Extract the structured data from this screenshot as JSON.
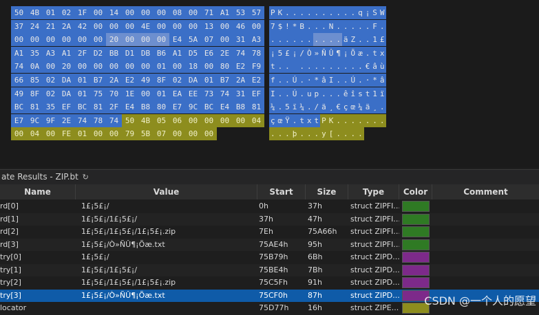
{
  "hex_rows": [
    {
      "bytes": [
        [
          "50",
          "b"
        ],
        [
          "4B",
          "b"
        ],
        [
          "01",
          "b"
        ],
        [
          "02",
          "b"
        ],
        [
          "1F",
          "b"
        ],
        [
          "00",
          "b"
        ],
        [
          "14",
          "b"
        ],
        [
          "00",
          "b"
        ],
        [
          "00",
          "b"
        ],
        [
          "00",
          "b"
        ],
        [
          "08",
          "b"
        ],
        [
          "00",
          "b"
        ],
        [
          "71",
          "b"
        ],
        [
          "A1",
          "b"
        ],
        [
          "53",
          "b"
        ],
        [
          "57",
          "b"
        ]
      ],
      "text": [
        [
          "P",
          "b"
        ],
        [
          "K",
          "b"
        ],
        [
          ".",
          "b"
        ],
        [
          ".",
          "b"
        ],
        [
          ".",
          "b"
        ],
        [
          ".",
          "b"
        ],
        [
          ".",
          "b"
        ],
        [
          ".",
          "b"
        ],
        [
          ".",
          "b"
        ],
        [
          ".",
          "b"
        ],
        [
          ".",
          "b"
        ],
        [
          ".",
          "b"
        ],
        [
          "q",
          "b"
        ],
        [
          "¡",
          "b"
        ],
        [
          "S",
          "b"
        ],
        [
          "W",
          "b"
        ]
      ]
    },
    {
      "bytes": [
        [
          "37",
          "b"
        ],
        [
          "24",
          "b"
        ],
        [
          "21",
          "b"
        ],
        [
          "2A",
          "b"
        ],
        [
          "42",
          "b"
        ],
        [
          "00",
          "b"
        ],
        [
          "00",
          "b"
        ],
        [
          "00",
          "b"
        ],
        [
          "4E",
          "b"
        ],
        [
          "00",
          "b"
        ],
        [
          "00",
          "b"
        ],
        [
          "00",
          "b"
        ],
        [
          "13",
          "b"
        ],
        [
          "00",
          "b"
        ],
        [
          "46",
          "b"
        ],
        [
          "00",
          "b"
        ]
      ],
      "text": [
        [
          "7",
          "b"
        ],
        [
          "$",
          "b"
        ],
        [
          "!",
          "b"
        ],
        [
          "*",
          "b"
        ],
        [
          "B",
          "b"
        ],
        [
          ".",
          "b"
        ],
        [
          ".",
          "b"
        ],
        [
          ".",
          "b"
        ],
        [
          "N",
          "b"
        ],
        [
          ".",
          "b"
        ],
        [
          ".",
          "b"
        ],
        [
          ".",
          "b"
        ],
        [
          ".",
          "b"
        ],
        [
          ".",
          "b"
        ],
        [
          "F",
          "b"
        ],
        [
          ".",
          "b"
        ]
      ]
    },
    {
      "bytes": [
        [
          "00",
          "b"
        ],
        [
          "00",
          "b"
        ],
        [
          "00",
          "b"
        ],
        [
          "00",
          "b"
        ],
        [
          "00",
          "b"
        ],
        [
          "00",
          "b"
        ],
        [
          "20",
          "bl"
        ],
        [
          "00",
          "bl"
        ],
        [
          "00",
          "bl"
        ],
        [
          "00",
          "bl"
        ],
        [
          "E4",
          "b"
        ],
        [
          "5A",
          "b"
        ],
        [
          "07",
          "b"
        ],
        [
          "00",
          "b"
        ],
        [
          "31",
          "b"
        ],
        [
          "A3",
          "b"
        ]
      ],
      "text": [
        [
          ".",
          "b"
        ],
        [
          ".",
          "b"
        ],
        [
          ".",
          "b"
        ],
        [
          ".",
          "b"
        ],
        [
          ".",
          "b"
        ],
        [
          ".",
          "b"
        ],
        [
          ".",
          "bl"
        ],
        [
          ".",
          "bl"
        ],
        [
          ".",
          "bl"
        ],
        [
          ".",
          "bl"
        ],
        [
          "ä",
          "b"
        ],
        [
          "Z",
          "b"
        ],
        [
          ".",
          "b"
        ],
        [
          ".",
          "b"
        ],
        [
          "1",
          "b"
        ],
        [
          "£",
          "b"
        ]
      ]
    },
    {
      "bytes": [
        [
          "A1",
          "b"
        ],
        [
          "35",
          "b"
        ],
        [
          "A3",
          "b"
        ],
        [
          "A1",
          "b"
        ],
        [
          "2F",
          "b"
        ],
        [
          "D2",
          "b"
        ],
        [
          "BB",
          "b"
        ],
        [
          "D1",
          "b"
        ],
        [
          "DB",
          "b"
        ],
        [
          "B6",
          "b"
        ],
        [
          "A1",
          "b"
        ],
        [
          "D5",
          "b"
        ],
        [
          "E6",
          "b"
        ],
        [
          "2E",
          "b"
        ],
        [
          "74",
          "b"
        ],
        [
          "78",
          "b"
        ]
      ],
      "text": [
        [
          "¡",
          "b"
        ],
        [
          "5",
          "b"
        ],
        [
          "£",
          "b"
        ],
        [
          "¡",
          "b"
        ],
        [
          "/",
          "b"
        ],
        [
          "Ò",
          "b"
        ],
        [
          "»",
          "b"
        ],
        [
          "Ñ",
          "b"
        ],
        [
          "Û",
          "b"
        ],
        [
          "¶",
          "b"
        ],
        [
          "¡",
          "b"
        ],
        [
          "Õ",
          "b"
        ],
        [
          "æ",
          "b"
        ],
        [
          ".",
          "b"
        ],
        [
          "t",
          "b"
        ],
        [
          "x",
          "b"
        ]
      ]
    },
    {
      "bytes": [
        [
          "74",
          "b"
        ],
        [
          "0A",
          "b"
        ],
        [
          "00",
          "b"
        ],
        [
          "20",
          "b"
        ],
        [
          "00",
          "b"
        ],
        [
          "00",
          "b"
        ],
        [
          "00",
          "b"
        ],
        [
          "00",
          "b"
        ],
        [
          "00",
          "b"
        ],
        [
          "01",
          "b"
        ],
        [
          "00",
          "b"
        ],
        [
          "18",
          "b"
        ],
        [
          "00",
          "b"
        ],
        [
          "80",
          "b"
        ],
        [
          "E2",
          "b"
        ],
        [
          "F9",
          "b"
        ]
      ],
      "text": [
        [
          "t",
          "b"
        ],
        [
          ".",
          "b"
        ],
        [
          ".",
          "b"
        ],
        [
          " ",
          "b"
        ],
        [
          ".",
          "b"
        ],
        [
          ".",
          "b"
        ],
        [
          ".",
          "b"
        ],
        [
          ".",
          "b"
        ],
        [
          ".",
          "b"
        ],
        [
          ".",
          "b"
        ],
        [
          ".",
          "b"
        ],
        [
          ".",
          "b"
        ],
        [
          ".",
          "b"
        ],
        [
          "€",
          "b"
        ],
        [
          "â",
          "b"
        ],
        [
          "ù",
          "b"
        ]
      ]
    },
    {
      "bytes": [
        [
          "66",
          "b"
        ],
        [
          "85",
          "b"
        ],
        [
          "02",
          "b"
        ],
        [
          "DA",
          "b"
        ],
        [
          "01",
          "b"
        ],
        [
          "B7",
          "b"
        ],
        [
          "2A",
          "b"
        ],
        [
          "E2",
          "b"
        ],
        [
          "49",
          "b"
        ],
        [
          "8F",
          "b"
        ],
        [
          "02",
          "b"
        ],
        [
          "DA",
          "b"
        ],
        [
          "01",
          "b"
        ],
        [
          "B7",
          "b"
        ],
        [
          "2A",
          "b"
        ],
        [
          "E2",
          "b"
        ]
      ],
      "text": [
        [
          "f",
          "b"
        ],
        [
          ".",
          "b"
        ],
        [
          ".",
          "b"
        ],
        [
          "Ú",
          "b"
        ],
        [
          ".",
          "b"
        ],
        [
          "·",
          "b"
        ],
        [
          "*",
          "b"
        ],
        [
          "â",
          "b"
        ],
        [
          "I",
          "b"
        ],
        [
          ".",
          "b"
        ],
        [
          ".",
          "b"
        ],
        [
          "Ú",
          "b"
        ],
        [
          ".",
          "b"
        ],
        [
          "·",
          "b"
        ],
        [
          "*",
          "b"
        ],
        [
          "â",
          "b"
        ]
      ]
    },
    {
      "bytes": [
        [
          "49",
          "b"
        ],
        [
          "8F",
          "b"
        ],
        [
          "02",
          "b"
        ],
        [
          "DA",
          "b"
        ],
        [
          "01",
          "b"
        ],
        [
          "75",
          "b"
        ],
        [
          "70",
          "b"
        ],
        [
          "1E",
          "b"
        ],
        [
          "00",
          "b"
        ],
        [
          "01",
          "b"
        ],
        [
          "EA",
          "b"
        ],
        [
          "EE",
          "b"
        ],
        [
          "73",
          "b"
        ],
        [
          "74",
          "b"
        ],
        [
          "31",
          "b"
        ],
        [
          "EF",
          "b"
        ]
      ],
      "text": [
        [
          "I",
          "b"
        ],
        [
          ".",
          "b"
        ],
        [
          ".",
          "b"
        ],
        [
          "Ú",
          "b"
        ],
        [
          ".",
          "b"
        ],
        [
          "u",
          "b"
        ],
        [
          "p",
          "b"
        ],
        [
          ".",
          "b"
        ],
        [
          ".",
          "b"
        ],
        [
          ".",
          "b"
        ],
        [
          "ê",
          "b"
        ],
        [
          "î",
          "b"
        ],
        [
          "s",
          "b"
        ],
        [
          "t",
          "b"
        ],
        [
          "1",
          "b"
        ],
        [
          "ï",
          "b"
        ]
      ]
    },
    {
      "bytes": [
        [
          "BC",
          "b"
        ],
        [
          "81",
          "b"
        ],
        [
          "35",
          "b"
        ],
        [
          "EF",
          "b"
        ],
        [
          "BC",
          "b"
        ],
        [
          "81",
          "b"
        ],
        [
          "2F",
          "b"
        ],
        [
          "E4",
          "b"
        ],
        [
          "B8",
          "b"
        ],
        [
          "80",
          "b"
        ],
        [
          "E7",
          "b"
        ],
        [
          "9C",
          "b"
        ],
        [
          "BC",
          "b"
        ],
        [
          "E4",
          "b"
        ],
        [
          "B8",
          "b"
        ],
        [
          "81",
          "b"
        ]
      ],
      "text": [
        [
          "¼",
          "b"
        ],
        [
          ".",
          "b"
        ],
        [
          "5",
          "b"
        ],
        [
          "ï",
          "b"
        ],
        [
          "¼",
          "b"
        ],
        [
          ".",
          "b"
        ],
        [
          "/",
          "b"
        ],
        [
          "ä",
          "b"
        ],
        [
          "¸",
          "b"
        ],
        [
          "€",
          "b"
        ],
        [
          "ç",
          "b"
        ],
        [
          "œ",
          "b"
        ],
        [
          "¼",
          "b"
        ],
        [
          "ä",
          "b"
        ],
        [
          "¸",
          "b"
        ],
        [
          ".",
          "b"
        ]
      ]
    },
    {
      "bytes": [
        [
          "E7",
          "b"
        ],
        [
          "9C",
          "b"
        ],
        [
          "9F",
          "b"
        ],
        [
          "2E",
          "b"
        ],
        [
          "74",
          "b"
        ],
        [
          "78",
          "b"
        ],
        [
          "74",
          "b"
        ],
        [
          "50",
          "g"
        ],
        [
          "4B",
          "g"
        ],
        [
          "05",
          "g"
        ],
        [
          "06",
          "g"
        ],
        [
          "00",
          "g"
        ],
        [
          "00",
          "g"
        ],
        [
          "00",
          "g"
        ],
        [
          "00",
          "g"
        ],
        [
          "04",
          "g"
        ]
      ],
      "text": [
        [
          "ç",
          "b"
        ],
        [
          "œ",
          "b"
        ],
        [
          "Ÿ",
          "b"
        ],
        [
          ".",
          "b"
        ],
        [
          "t",
          "b"
        ],
        [
          "x",
          "b"
        ],
        [
          "t",
          "b"
        ],
        [
          "P",
          "g"
        ],
        [
          "K",
          "g"
        ],
        [
          ".",
          "g"
        ],
        [
          ".",
          "g"
        ],
        [
          ".",
          "g"
        ],
        [
          ".",
          "g"
        ],
        [
          ".",
          "g"
        ],
        [
          ".",
          "g"
        ],
        [
          ".",
          "g"
        ]
      ]
    },
    {
      "bytes": [
        [
          "00",
          "g"
        ],
        [
          "04",
          "g"
        ],
        [
          "00",
          "g"
        ],
        [
          "FE",
          "g"
        ],
        [
          "01",
          "g"
        ],
        [
          "00",
          "g"
        ],
        [
          "00",
          "g"
        ],
        [
          "79",
          "g"
        ],
        [
          "5B",
          "g"
        ],
        [
          "07",
          "g"
        ],
        [
          "00",
          "g"
        ],
        [
          "00",
          "g"
        ],
        [
          "00",
          "g"
        ]
      ],
      "text": [
        [
          ".",
          "g"
        ],
        [
          ".",
          "g"
        ],
        [
          ".",
          "g"
        ],
        [
          "þ",
          "g"
        ],
        [
          ".",
          "g"
        ],
        [
          ".",
          "g"
        ],
        [
          ".",
          "g"
        ],
        [
          "y",
          "g"
        ],
        [
          "[",
          "g"
        ],
        [
          ".",
          "g"
        ],
        [
          ".",
          "g"
        ],
        [
          ".",
          "g"
        ],
        [
          ".",
          "g"
        ]
      ]
    }
  ],
  "results_panel": {
    "title": "ate Results - ZIP.bt",
    "refresh_glyph": "↻",
    "columns": [
      "Name",
      "Value",
      "Start",
      "Size",
      "Type",
      "Color",
      "Comment"
    ],
    "rows": [
      {
        "name": "rd[0]",
        "value": "1£¡5£¡/",
        "start": "0h",
        "size": "37h",
        "type": "struct ZIPFI...",
        "color": "#2f7a24",
        "selected": false
      },
      {
        "name": "rd[1]",
        "value": "1£¡5£¡/1£¡5£¡/",
        "start": "37h",
        "size": "47h",
        "type": "struct ZIPFI...",
        "color": "#2f7a24",
        "selected": false
      },
      {
        "name": "rd[2]",
        "value": "1£¡5£¡/1£¡5£¡/1£¡5£¡.zip",
        "start": "7Eh",
        "size": "75A66h",
        "type": "struct ZIPFI...",
        "color": "#2f7a24",
        "selected": false
      },
      {
        "name": "rd[3]",
        "value": "1£¡5£¡/Ò»ÑÛ¶¡Õæ.txt",
        "start": "75AE4h",
        "size": "95h",
        "type": "struct ZIPFI...",
        "color": "#2f7a24",
        "selected": false
      },
      {
        "name": "try[0]",
        "value": "1£¡5£¡/",
        "start": "75B79h",
        "size": "6Bh",
        "type": "struct ZIPD...",
        "color": "#7d2a8a",
        "selected": false
      },
      {
        "name": "try[1]",
        "value": "1£¡5£¡/1£¡5£¡/",
        "start": "75BE4h",
        "size": "7Bh",
        "type": "struct ZIPD...",
        "color": "#7d2a8a",
        "selected": false
      },
      {
        "name": "try[2]",
        "value": "1£¡5£¡/1£¡5£¡/1£¡5£¡.zip",
        "start": "75C5Fh",
        "size": "91h",
        "type": "struct ZIPD...",
        "color": "#7d2a8a",
        "selected": false
      },
      {
        "name": "try[3]",
        "value": "1£¡5£¡/Ò»ÑÛ¶¡Õæ.txt",
        "start": "75CF0h",
        "size": "87h",
        "type": "struct ZIPD...",
        "color": "#7d2a8a",
        "selected": true
      },
      {
        "name": "locator",
        "value": "",
        "start": "75D77h",
        "size": "16h",
        "type": "struct ZIPE...",
        "color": "#8d8d1e",
        "selected": false
      }
    ]
  },
  "watermark": "CSDN @一个人的愿望"
}
